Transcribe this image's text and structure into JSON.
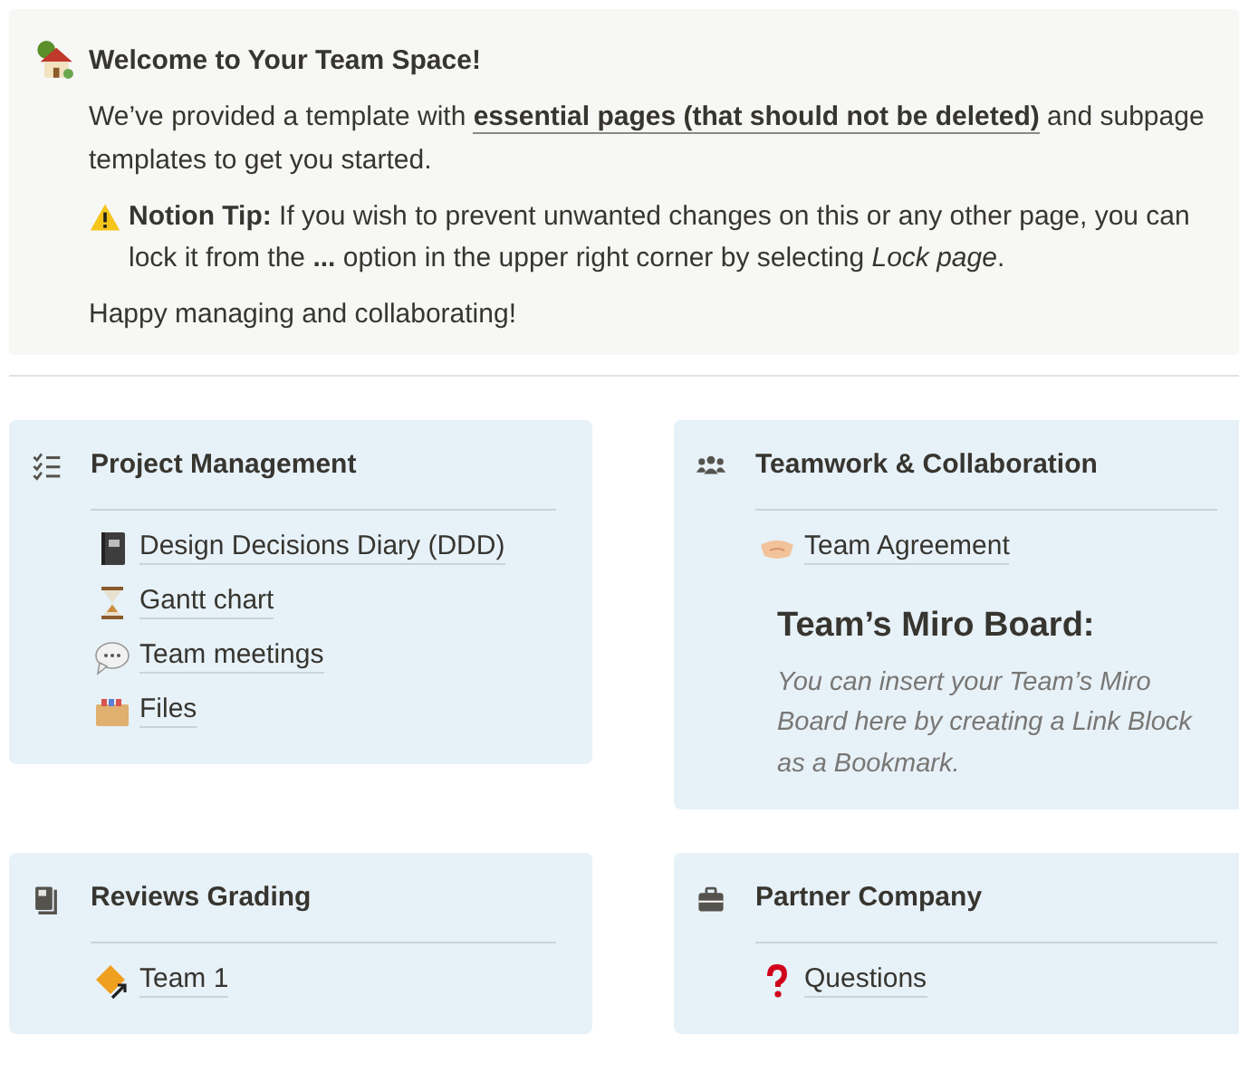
{
  "callout": {
    "title": "Welcome to Your Team Space!",
    "intro": {
      "before": "We’ve provided a template with",
      "link": "essential pages (that should not be deleted)",
      "after": "and subpage templates to get you started."
    },
    "tip": "**Notion Tip:** If you wish to prevent unwanted changes on this or any other page, you can lock it from the **...** option in the upper right corner by selecting *Lock page*.",
    "closing": "Happy managing and collaborating!"
  },
  "cards": [
    {
      "title": "Project Management",
      "links": [
        "Design Decisions Diary (DDD)",
        "Gantt chart",
        "Team meetings",
        "Files"
      ]
    },
    {
      "title": "Teamwork & Collaboration",
      "links": [
        "Team Agreement"
      ],
      "heading": "Team’s Miro Board:",
      "note": "You can insert your Team’s Miro Board here by creating a Link Block as a Bookmark."
    },
    {
      "title": "Reviews Grading",
      "links": [
        "Team 1"
      ]
    },
    {
      "title": "Partner Company",
      "links": [
        "Questions"
      ]
    }
  ]
}
